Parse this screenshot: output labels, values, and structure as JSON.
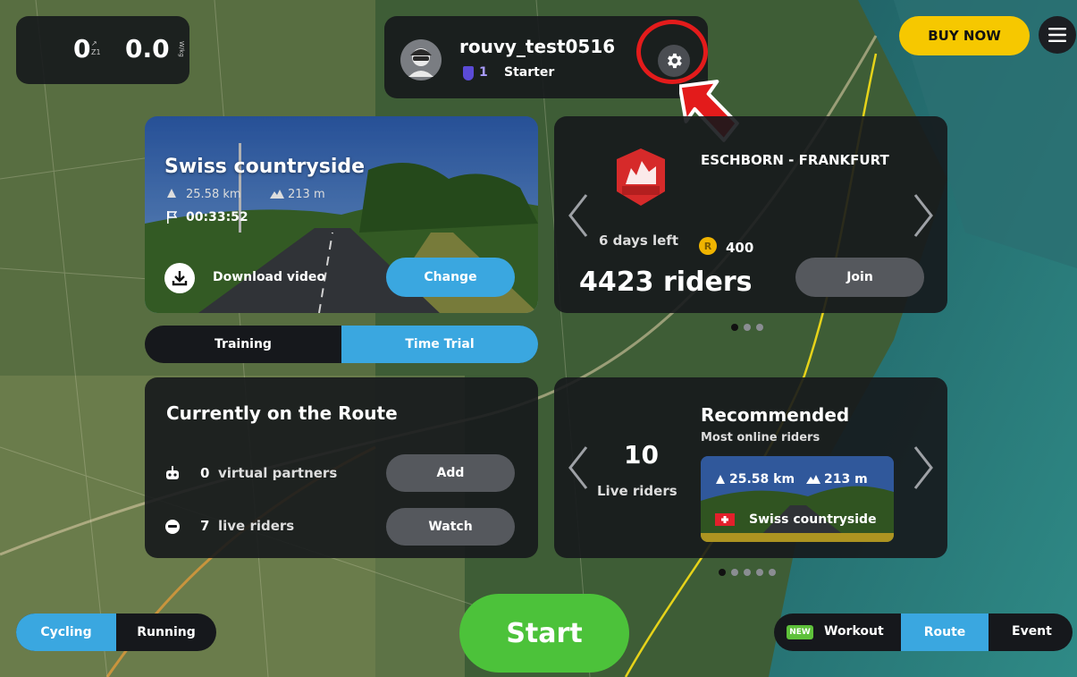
{
  "stats": {
    "power": "0",
    "power_zone_top": "↗",
    "power_zone": "Z1",
    "wkg": "0.0",
    "wkg_unit": "W/kg"
  },
  "profile": {
    "username": "rouvy_test0516",
    "level": "1",
    "level_name": "Starter"
  },
  "header": {
    "buy_now_label": "BUY NOW"
  },
  "route_card": {
    "title": "Swiss countryside",
    "distance": "25.58 km",
    "elevation": "213 m",
    "time": "00:33:52",
    "download_label": "Download video",
    "change_label": "Change"
  },
  "event_card": {
    "title": "ESCHBORN - FRANKFURT",
    "logo_text": "ESCHBORN FRANKFURT",
    "days_left": "6 days left",
    "coins": "400",
    "riders": "4423 riders",
    "join_label": "Join"
  },
  "mode_toggle": {
    "training": "Training",
    "time_trial": "Time Trial"
  },
  "on_route": {
    "title": "Currently on the Route",
    "partners_count": "0",
    "partners_label": "virtual partners",
    "add_label": "Add",
    "riders_count": "7",
    "riders_label": "live riders",
    "watch_label": "Watch"
  },
  "recommended": {
    "title": "Recommended",
    "subtitle": "Most online riders",
    "live_count": "10",
    "live_label": "Live riders",
    "route_distance": "25.58 km",
    "route_elevation": "213 m",
    "route_name": "Swiss countryside"
  },
  "sport_toggle": {
    "cycling": "Cycling",
    "running": "Running"
  },
  "start_label": "Start",
  "category_tabs": {
    "new_badge": "NEW",
    "workout": "Workout",
    "route": "Route",
    "event": "Event"
  },
  "colors": {
    "accent_blue": "#3aa7e0",
    "start_green": "#4cc23a",
    "buy_yellow": "#f6c800",
    "highlight_red": "#e31b1b"
  }
}
